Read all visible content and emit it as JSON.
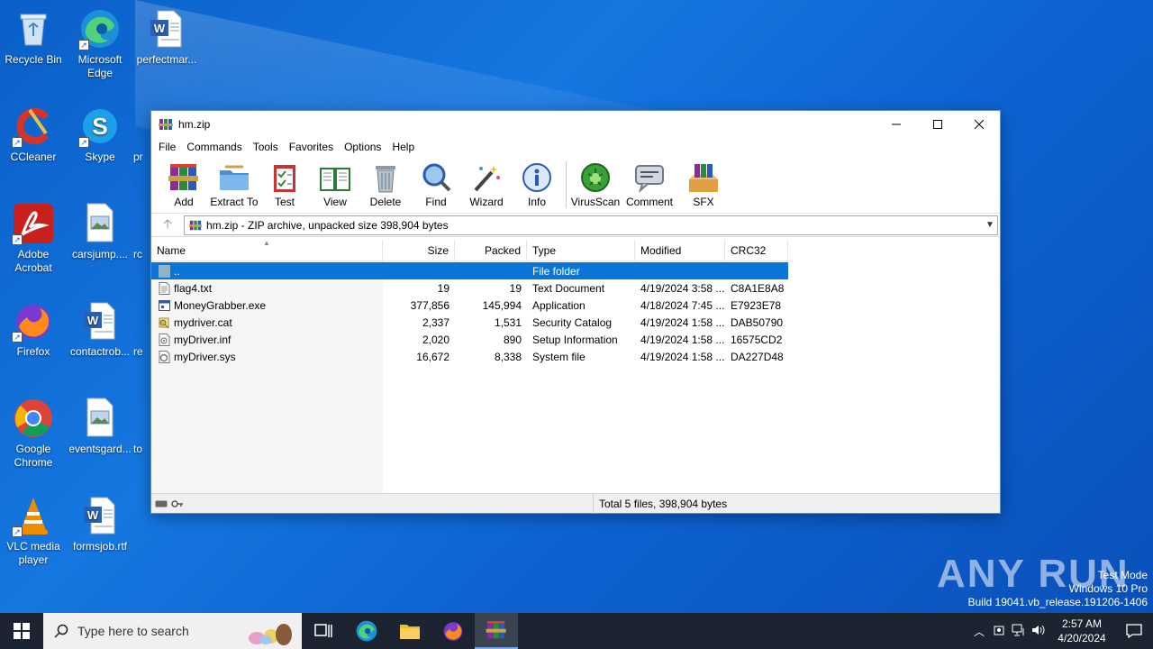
{
  "desktop": {
    "icons": [
      {
        "label": "Recycle Bin",
        "icon": "recycle-bin-icon"
      },
      {
        "label": "Microsoft Edge",
        "icon": "edge-icon"
      },
      {
        "label": "perfectmar...",
        "icon": "word-doc-icon"
      },
      {
        "label": "CCleaner",
        "icon": "ccleaner-icon"
      },
      {
        "label": "Skype",
        "icon": "skype-icon"
      },
      {
        "label": "pr",
        "icon": "partial-icon"
      },
      {
        "label": "Adobe Acrobat",
        "icon": "acrobat-icon"
      },
      {
        "label": "carsjump....",
        "icon": "image-file-icon"
      },
      {
        "label": "rc",
        "icon": "partial-icon"
      },
      {
        "label": "Firefox",
        "icon": "firefox-icon"
      },
      {
        "label": "contactrob...",
        "icon": "word-doc-icon"
      },
      {
        "label": "re",
        "icon": "partial-icon"
      },
      {
        "label": "Google Chrome",
        "icon": "chrome-icon"
      },
      {
        "label": "eventsgard...",
        "icon": "image-file-icon"
      },
      {
        "label": "to",
        "icon": "partial-icon"
      },
      {
        "label": "VLC media player",
        "icon": "vlc-icon"
      },
      {
        "label": "formsjob.rtf",
        "icon": "word-doc-icon"
      }
    ]
  },
  "window": {
    "title": "hm.zip",
    "menu": [
      "File",
      "Commands",
      "Tools",
      "Favorites",
      "Options",
      "Help"
    ],
    "toolbar": [
      {
        "label": "Add",
        "icon": "add-archive-icon"
      },
      {
        "label": "Extract To",
        "icon": "extract-folder-icon"
      },
      {
        "label": "Test",
        "icon": "test-clipboard-icon"
      },
      {
        "label": "View",
        "icon": "view-book-icon"
      },
      {
        "label": "Delete",
        "icon": "trash-icon"
      },
      {
        "label": "Find",
        "icon": "magnifier-icon"
      },
      {
        "label": "Wizard",
        "icon": "wand-icon"
      },
      {
        "label": "Info",
        "icon": "info-icon"
      },
      {
        "label": "VirusScan",
        "icon": "virus-scan-icon"
      },
      {
        "label": "Comment",
        "icon": "comment-icon"
      },
      {
        "label": "SFX",
        "icon": "sfx-box-icon"
      }
    ],
    "address": "hm.zip - ZIP archive, unpacked size 398,904 bytes",
    "columns": {
      "name": "Name",
      "size": "Size",
      "packed": "Packed",
      "type": "Type",
      "modified": "Modified",
      "crc": "CRC32"
    },
    "rows": [
      {
        "name": "..",
        "size": "",
        "packed": "",
        "type": "File folder",
        "modified": "",
        "crc": "",
        "icon": "folder-up-icon",
        "selected": true
      },
      {
        "name": "flag4.txt",
        "size": "19",
        "packed": "19",
        "type": "Text Document",
        "modified": "4/19/2024 3:58 ...",
        "crc": "C8A1E8A8",
        "icon": "text-file-icon"
      },
      {
        "name": "MoneyGrabber.exe",
        "size": "377,856",
        "packed": "145,994",
        "type": "Application",
        "modified": "4/18/2024 7:45 ...",
        "crc": "E7923E78",
        "icon": "exe-file-icon"
      },
      {
        "name": "mydriver.cat",
        "size": "2,337",
        "packed": "1,531",
        "type": "Security Catalog",
        "modified": "4/19/2024 1:58 ...",
        "crc": "DAB50790",
        "icon": "catalog-file-icon"
      },
      {
        "name": "myDriver.inf",
        "size": "2,020",
        "packed": "890",
        "type": "Setup Information",
        "modified": "4/19/2024 1:58 ...",
        "crc": "16575CD2",
        "icon": "inf-file-icon"
      },
      {
        "name": "myDriver.sys",
        "size": "16,672",
        "packed": "8,338",
        "type": "System file",
        "modified": "4/19/2024 1:58 ...",
        "crc": "DA227D48",
        "icon": "sys-file-icon"
      }
    ],
    "status": "Total 5 files, 398,904 bytes"
  },
  "watermark": {
    "brand": "ANY RUN",
    "line1": "Test Mode",
    "line2": "Windows 10 Pro",
    "line3": "Build 19041.vb_release.191206-1406"
  },
  "taskbar": {
    "search_placeholder": "Type here to search",
    "time": "2:57 AM",
    "date": "4/20/2024"
  }
}
